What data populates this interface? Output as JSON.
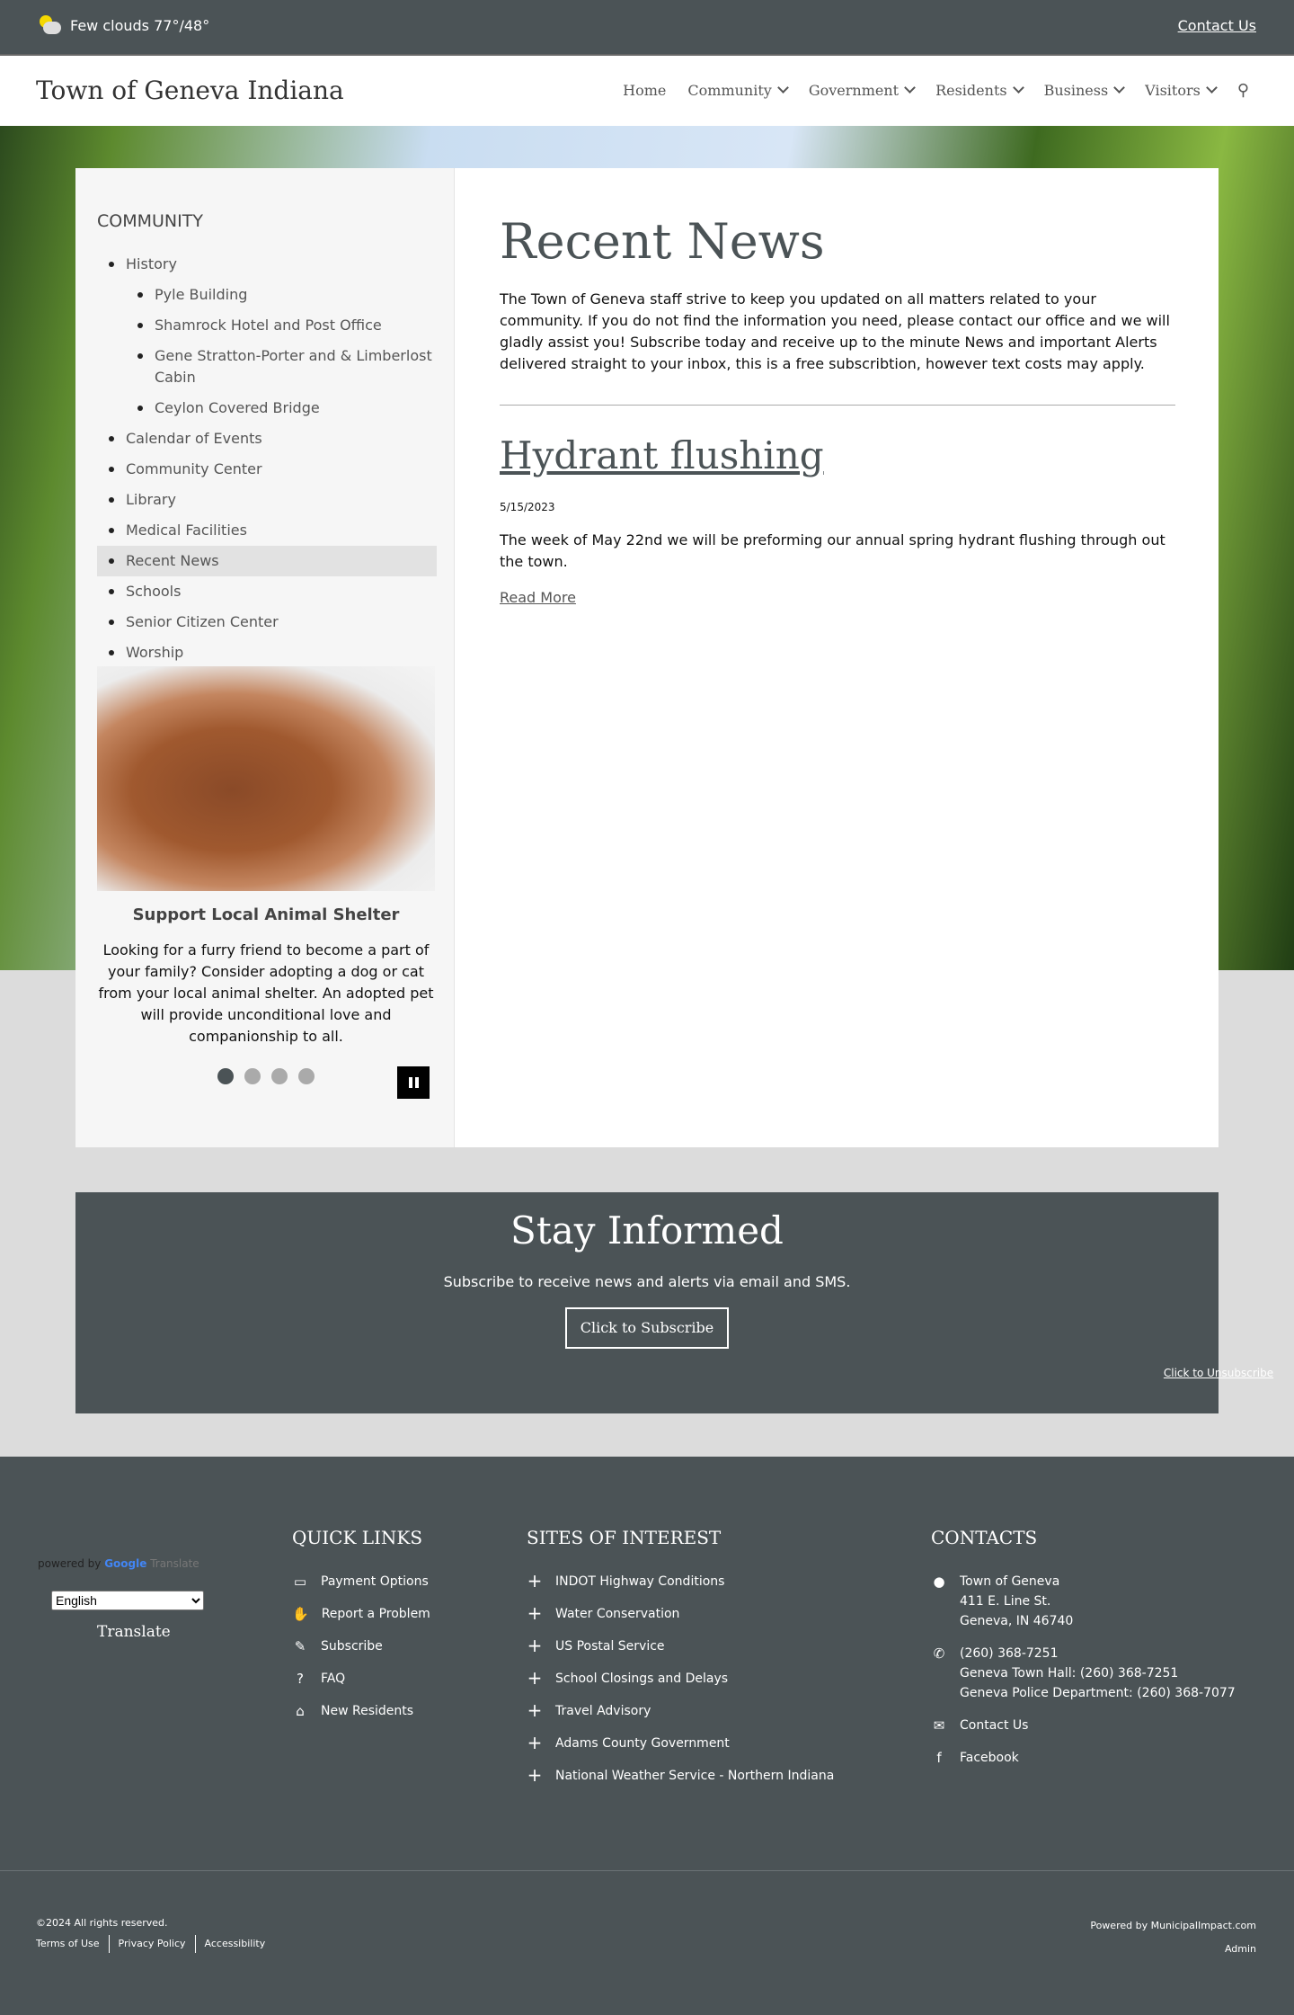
{
  "topbar": {
    "weather": "Few clouds 77°/48°",
    "weather_icon": "partly-cloudy-icon",
    "contact": "Contact Us"
  },
  "header": {
    "title": "Town of Geneva Indiana",
    "nav": [
      "Home",
      "Community",
      "Government",
      "Residents",
      "Business",
      "Visitors"
    ]
  },
  "sidebar": {
    "heading": "COMMUNITY",
    "items": [
      {
        "label": "History",
        "sub": false
      },
      {
        "label": "Pyle Building",
        "sub": true
      },
      {
        "label": "Shamrock Hotel and Post Office",
        "sub": true
      },
      {
        "label": "Gene Stratton-Porter and & Limberlost Cabin",
        "sub": true
      },
      {
        "label": "Ceylon Covered Bridge",
        "sub": true
      },
      {
        "label": "Calendar of Events",
        "sub": false
      },
      {
        "label": "Community Center",
        "sub": false
      },
      {
        "label": "Library",
        "sub": false
      },
      {
        "label": "Medical Facilities",
        "sub": false
      },
      {
        "label": "Recent News",
        "sub": false,
        "active": true
      },
      {
        "label": "Schools",
        "sub": false
      },
      {
        "label": "Senior Citizen Center",
        "sub": false
      },
      {
        "label": "Worship",
        "sub": false
      }
    ],
    "slide": {
      "title": "Support Local Animal Shelter",
      "text": "Looking for a furry friend to become a part of your family? Consider adopting a dog or cat from your local animal shelter. An adopted pet will provide unconditional love and companionship to all.",
      "total": 4,
      "current": 1
    }
  },
  "main": {
    "title": "Recent News",
    "intro": "The Town of Geneva staff strive to keep you updated on all matters related to your community. If you do not find the information you need, please contact our office and we will gladly assist you!  Subscribe today and receive up to the minute News and important Alerts delivered straight to your inbox, this is a free subscribtion, however text costs may apply.",
    "news": {
      "title": "Hydrant flushing",
      "date": "5/15/2023",
      "body": "The week of May 22nd we will be preforming our annual spring hydrant flushing through out the town.",
      "read_more": "Read More"
    }
  },
  "stay": {
    "title": "Stay Informed",
    "subtitle": "Subscribe to receive news and alerts via email and SMS.",
    "button": "Click to Subscribe",
    "unsubscribe": "Click to Unsubscribe"
  },
  "footer": {
    "translate": {
      "powered": "powered by",
      "google": "Google",
      "word": "Translate",
      "language": "English",
      "button": "Translate"
    },
    "quick_links": {
      "heading": "QUICK LINKS",
      "items": [
        {
          "label": "Payment Options",
          "icon": "credit-card-icon",
          "glyph": "▭"
        },
        {
          "label": "Report a Problem",
          "icon": "hand-icon",
          "glyph": "✋"
        },
        {
          "label": "Subscribe",
          "icon": "pencil-icon",
          "glyph": "✎"
        },
        {
          "label": "FAQ",
          "icon": "question-circle-icon",
          "glyph": "?"
        },
        {
          "label": "New Residents",
          "icon": "home-icon",
          "glyph": "⌂"
        }
      ]
    },
    "sites": {
      "heading": "SITES OF INTEREST",
      "items": [
        "INDOT Highway Conditions",
        "Water Conservation",
        "US Postal Service",
        "School Closings and Delays",
        "Travel Advisory",
        "Adams County Government",
        "National Weather Service - Northern Indiana"
      ]
    },
    "contacts": {
      "heading": "CONTACTS",
      "address": [
        "Town of Geneva",
        "411 E. Line St.",
        "Geneva, IN 46740"
      ],
      "phones": [
        "(260) 368-7251",
        "Geneva Town Hall: (260) 368-7251",
        "Geneva Police Department: (260) 368-7077"
      ],
      "contact": "Contact Us",
      "facebook": "Facebook"
    },
    "copyright": "©2024 All rights reserved.",
    "legal": [
      "Terms of Use",
      "Privacy Policy",
      "Accessibility"
    ],
    "powered": "Powered by MunicipalImpact.com",
    "admin": "Admin"
  }
}
